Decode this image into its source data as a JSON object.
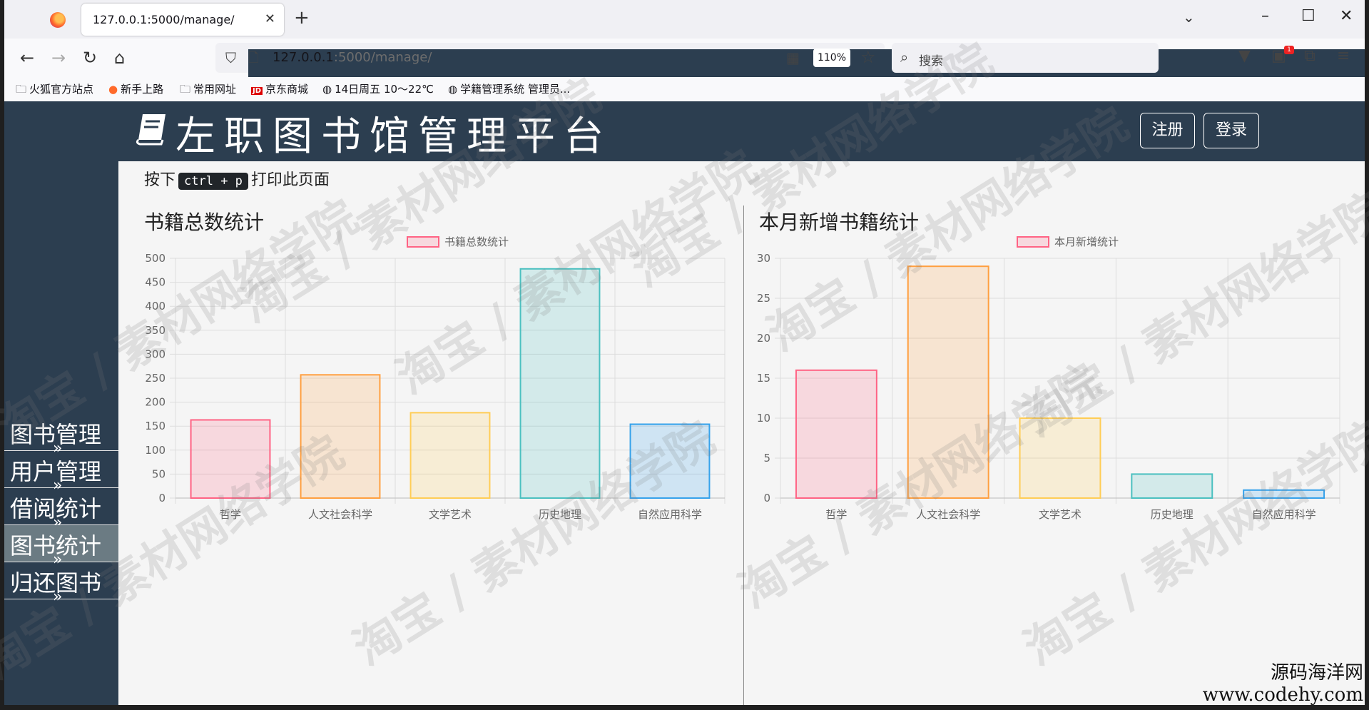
{
  "browser": {
    "tab_title": "127.0.0.1:5000/manage/",
    "url_host": "127.0.0.1",
    "url_rest": ":5000/manage/",
    "zoom": "110%",
    "search_placeholder": "搜索",
    "badge": "1",
    "bookmarks": [
      "火狐官方站点",
      "新手上路",
      "常用网址",
      "京东商城",
      "14日周五 10～22℃",
      "学籍管理系统 管理员..."
    ]
  },
  "header": {
    "brand": "左职图书馆管理平台",
    "register": "注册",
    "login": "登录"
  },
  "sidebar": {
    "items": [
      {
        "label": "图书管理",
        "arrow": "»"
      },
      {
        "label": "用户管理",
        "arrow": "»"
      },
      {
        "label": "借阅统计",
        "arrow": "»"
      },
      {
        "label": "图书统计",
        "arrow": "»"
      },
      {
        "label": "归还图书",
        "arrow": "»"
      }
    ],
    "active_index": 3
  },
  "hint": {
    "before": "按下",
    "key": "ctrl + p",
    "after": "打印此页面"
  },
  "chart_data": [
    {
      "type": "bar",
      "title": "书籍总数统计",
      "categories": [
        "哲学",
        "人文社会科学",
        "文学艺术",
        "历史地理",
        "自然应用科学"
      ],
      "series": [
        {
          "name": "书籍总数统计",
          "values": [
            163,
            257,
            178,
            478,
            154
          ]
        }
      ],
      "ylim": [
        0,
        500
      ],
      "yticks": [
        0,
        50,
        100,
        150,
        200,
        250,
        300,
        350,
        400,
        450,
        500
      ],
      "legend": "top-center",
      "grid": true
    },
    {
      "type": "bar",
      "title": "本月新增书籍统计",
      "categories": [
        "哲学",
        "人文社会科学",
        "文学艺术",
        "历史地理",
        "自然应用科学"
      ],
      "series": [
        {
          "name": "本月新增统计",
          "values": [
            16,
            29,
            10,
            3,
            1
          ]
        }
      ],
      "ylim": [
        0,
        30
      ],
      "yticks": [
        0,
        5,
        10,
        15,
        20,
        25,
        30
      ],
      "legend": "top-center",
      "grid": true
    }
  ],
  "bar_colors": {
    "fill": [
      "rgba(255,99,132,0.2)",
      "rgba(255,159,64,0.2)",
      "rgba(255,205,86,0.2)",
      "rgba(75,192,192,0.2)",
      "rgba(54,162,235,0.2)"
    ],
    "stroke": [
      "#ff6384",
      "#ff9f40",
      "#ffcd56",
      "#4bc0c0",
      "#36a2eb"
    ]
  },
  "watermark": {
    "text": "淘宝 / 素材网络学院",
    "corner_line1": "源码海洋网",
    "corner_line2": "www.codehy.com"
  }
}
